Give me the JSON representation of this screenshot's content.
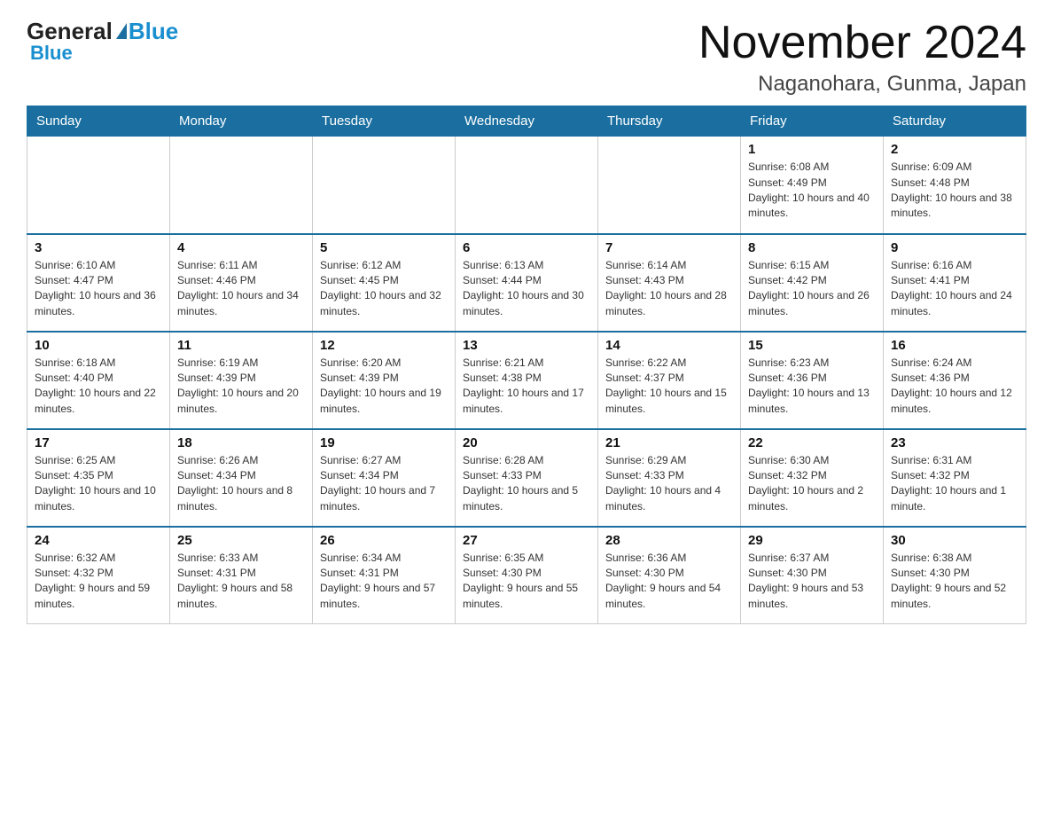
{
  "logo": {
    "general": "General",
    "blue": "Blue"
  },
  "title": "November 2024",
  "location": "Naganohara, Gunma, Japan",
  "days_of_week": [
    "Sunday",
    "Monday",
    "Tuesday",
    "Wednesday",
    "Thursday",
    "Friday",
    "Saturday"
  ],
  "weeks": [
    [
      {
        "num": "",
        "info": ""
      },
      {
        "num": "",
        "info": ""
      },
      {
        "num": "",
        "info": ""
      },
      {
        "num": "",
        "info": ""
      },
      {
        "num": "",
        "info": ""
      },
      {
        "num": "1",
        "info": "Sunrise: 6:08 AM\nSunset: 4:49 PM\nDaylight: 10 hours and 40 minutes."
      },
      {
        "num": "2",
        "info": "Sunrise: 6:09 AM\nSunset: 4:48 PM\nDaylight: 10 hours and 38 minutes."
      }
    ],
    [
      {
        "num": "3",
        "info": "Sunrise: 6:10 AM\nSunset: 4:47 PM\nDaylight: 10 hours and 36 minutes."
      },
      {
        "num": "4",
        "info": "Sunrise: 6:11 AM\nSunset: 4:46 PM\nDaylight: 10 hours and 34 minutes."
      },
      {
        "num": "5",
        "info": "Sunrise: 6:12 AM\nSunset: 4:45 PM\nDaylight: 10 hours and 32 minutes."
      },
      {
        "num": "6",
        "info": "Sunrise: 6:13 AM\nSunset: 4:44 PM\nDaylight: 10 hours and 30 minutes."
      },
      {
        "num": "7",
        "info": "Sunrise: 6:14 AM\nSunset: 4:43 PM\nDaylight: 10 hours and 28 minutes."
      },
      {
        "num": "8",
        "info": "Sunrise: 6:15 AM\nSunset: 4:42 PM\nDaylight: 10 hours and 26 minutes."
      },
      {
        "num": "9",
        "info": "Sunrise: 6:16 AM\nSunset: 4:41 PM\nDaylight: 10 hours and 24 minutes."
      }
    ],
    [
      {
        "num": "10",
        "info": "Sunrise: 6:18 AM\nSunset: 4:40 PM\nDaylight: 10 hours and 22 minutes."
      },
      {
        "num": "11",
        "info": "Sunrise: 6:19 AM\nSunset: 4:39 PM\nDaylight: 10 hours and 20 minutes."
      },
      {
        "num": "12",
        "info": "Sunrise: 6:20 AM\nSunset: 4:39 PM\nDaylight: 10 hours and 19 minutes."
      },
      {
        "num": "13",
        "info": "Sunrise: 6:21 AM\nSunset: 4:38 PM\nDaylight: 10 hours and 17 minutes."
      },
      {
        "num": "14",
        "info": "Sunrise: 6:22 AM\nSunset: 4:37 PM\nDaylight: 10 hours and 15 minutes."
      },
      {
        "num": "15",
        "info": "Sunrise: 6:23 AM\nSunset: 4:36 PM\nDaylight: 10 hours and 13 minutes."
      },
      {
        "num": "16",
        "info": "Sunrise: 6:24 AM\nSunset: 4:36 PM\nDaylight: 10 hours and 12 minutes."
      }
    ],
    [
      {
        "num": "17",
        "info": "Sunrise: 6:25 AM\nSunset: 4:35 PM\nDaylight: 10 hours and 10 minutes."
      },
      {
        "num": "18",
        "info": "Sunrise: 6:26 AM\nSunset: 4:34 PM\nDaylight: 10 hours and 8 minutes."
      },
      {
        "num": "19",
        "info": "Sunrise: 6:27 AM\nSunset: 4:34 PM\nDaylight: 10 hours and 7 minutes."
      },
      {
        "num": "20",
        "info": "Sunrise: 6:28 AM\nSunset: 4:33 PM\nDaylight: 10 hours and 5 minutes."
      },
      {
        "num": "21",
        "info": "Sunrise: 6:29 AM\nSunset: 4:33 PM\nDaylight: 10 hours and 4 minutes."
      },
      {
        "num": "22",
        "info": "Sunrise: 6:30 AM\nSunset: 4:32 PM\nDaylight: 10 hours and 2 minutes."
      },
      {
        "num": "23",
        "info": "Sunrise: 6:31 AM\nSunset: 4:32 PM\nDaylight: 10 hours and 1 minute."
      }
    ],
    [
      {
        "num": "24",
        "info": "Sunrise: 6:32 AM\nSunset: 4:32 PM\nDaylight: 9 hours and 59 minutes."
      },
      {
        "num": "25",
        "info": "Sunrise: 6:33 AM\nSunset: 4:31 PM\nDaylight: 9 hours and 58 minutes."
      },
      {
        "num": "26",
        "info": "Sunrise: 6:34 AM\nSunset: 4:31 PM\nDaylight: 9 hours and 57 minutes."
      },
      {
        "num": "27",
        "info": "Sunrise: 6:35 AM\nSunset: 4:30 PM\nDaylight: 9 hours and 55 minutes."
      },
      {
        "num": "28",
        "info": "Sunrise: 6:36 AM\nSunset: 4:30 PM\nDaylight: 9 hours and 54 minutes."
      },
      {
        "num": "29",
        "info": "Sunrise: 6:37 AM\nSunset: 4:30 PM\nDaylight: 9 hours and 53 minutes."
      },
      {
        "num": "30",
        "info": "Sunrise: 6:38 AM\nSunset: 4:30 PM\nDaylight: 9 hours and 52 minutes."
      }
    ]
  ]
}
